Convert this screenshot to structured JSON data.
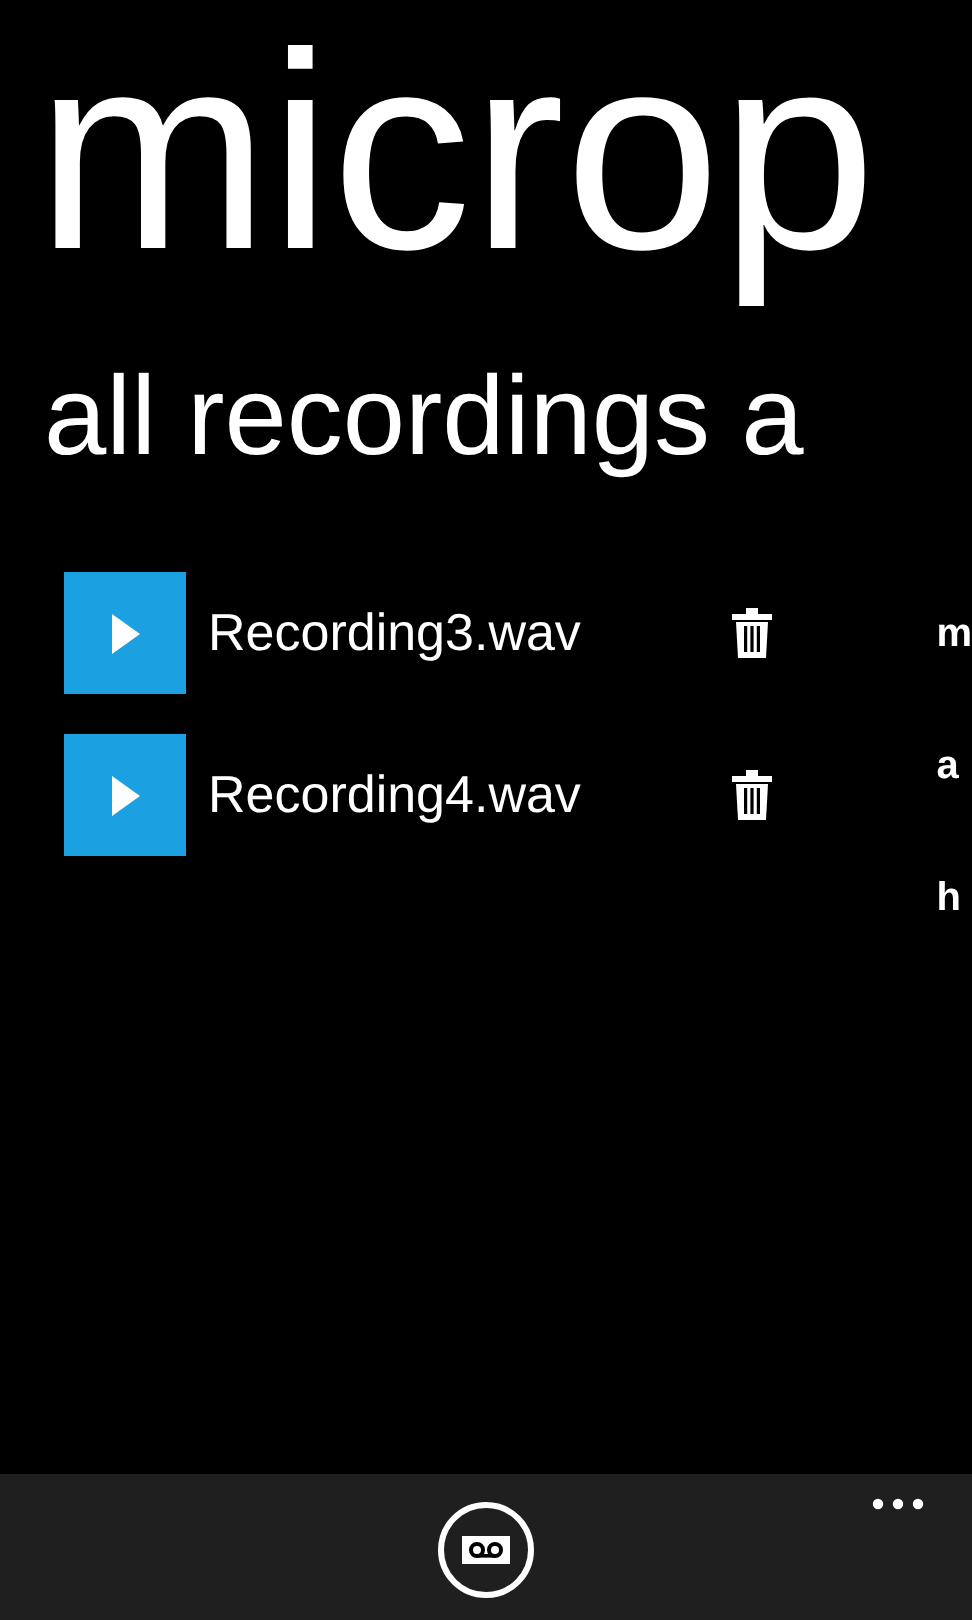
{
  "app_title": "microp",
  "section_title": "all recordings a",
  "recordings": [
    {
      "name": "Recording3.wav"
    },
    {
      "name": "Recording4.wav"
    }
  ],
  "next_section_items": [
    "m",
    "a",
    "h"
  ]
}
